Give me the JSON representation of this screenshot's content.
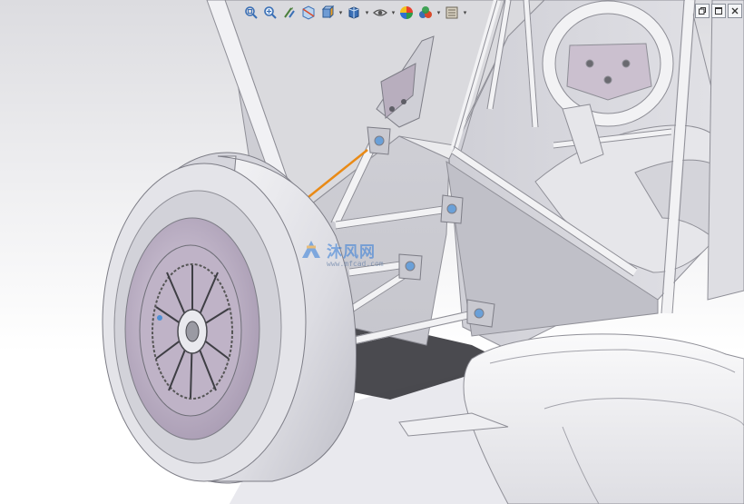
{
  "window": {
    "title": "",
    "accent_color": "#e98a16"
  },
  "hud_toolbar": {
    "items": [
      {
        "icon": "zoom-to-fit-icon"
      },
      {
        "icon": "zoom-to-area-icon"
      },
      {
        "icon": "previous-view-icon"
      },
      {
        "icon": "section-view-icon"
      },
      {
        "icon": "view-orientation-icon"
      },
      {
        "icon": "display-style-icon"
      },
      {
        "icon": "hide-show-items-icon"
      },
      {
        "icon": "edit-appearance-icon"
      },
      {
        "icon": "apply-scene-icon"
      },
      {
        "icon": "view-settings-icon"
      }
    ]
  },
  "watermark": {
    "text": "沐风网",
    "subtext": "www.mfcad.com"
  },
  "model": {
    "body_color": "#ececf0",
    "shadow_color": "#b9b9c2",
    "selection_color": "#e98a16"
  }
}
